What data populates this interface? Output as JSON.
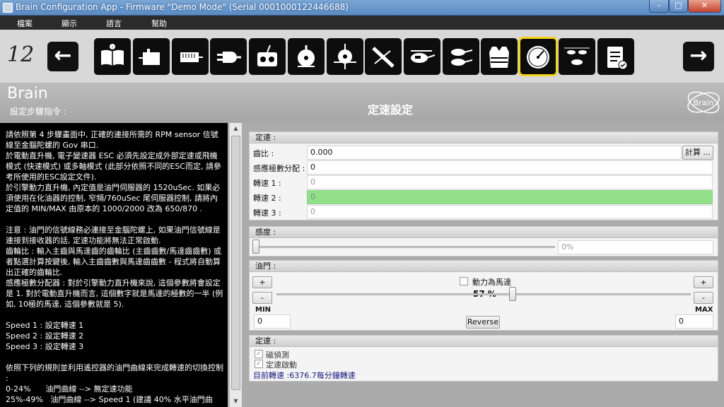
{
  "window": {
    "title": "Brain Configuration App - Firmware \"Demo Mode\" (Serial 0001000122446688)",
    "min": "–",
    "max": "□",
    "close": "✕"
  },
  "menu": [
    "檔案",
    "顯示",
    "語言",
    "幫助"
  ],
  "toolbar": {
    "step_number": "12",
    "back_arrow": "←",
    "forward_arrow": "→",
    "icons": [
      "manual-icon",
      "control-box-icon",
      "receiver-icon",
      "plug-icon",
      "transmitter-icon",
      "swashplate-icon",
      "rotor-head-icon",
      "tail-rotor-icon",
      "helicopter-icon",
      "helicopter-stabilized-icon",
      "helicopters-icon",
      "vest-icon",
      "speedometer-icon",
      "helicopters-flight-icon",
      "checklist-icon"
    ],
    "active_icon": "speedometer-icon"
  },
  "header": {
    "brand": "Brain",
    "subtitle": "設定步驟指令 :",
    "title": "定速設定",
    "logo_text": "Brain"
  },
  "instructions": [
    "請依照第 4 步驟畫面中, 正確的連接所需的 RPM sensor 信號線至金腦陀螺的 Gov 串口.",
    "於電動直升機, 電子變速器 ESC 必須先設定成外部定速或飛機模式 (快速模式) 或多軸模式 (此部分依照不同的ESC而定, 請參考所使用的ESC設定文件).",
    "於引擎動力直升機, 內定值是油門伺服器的 1520uSec. 如果必須使用在化油器的控制, 窄頻/760uSec 尾伺服器控制, 請將內定值的 MIN/MAX 由原本的 1000/2000 改為 650/870 .",
    "",
    "注意 : 油門的信號線務必連接至金腦陀螺上, 如果油門信號線是連接到接收器的話, 定速功能將無法正常啟動.",
    "齒輪比 : 輸入主齒與馬達齒的齒輪比 (主齒齒數/馬達齒齒數) 或者點選計算按鍵後, 輸入主齒齒數與馬達齒齒數 - 程式將自動算出正確的齒輪比.",
    "感應極數分配器 : 對於引擎動力直升機來說, 這個參數將會設定是 1. 對於電動直升機而言, 這個數字就是馬達的極數的一半 (例如, 10極的馬達, 這個參數就是 5).",
    "",
    "Speed 1 : 設定轉速 1",
    "Speed 2 : 設定轉速 2",
    "Speed 3 : 設定轉速 3",
    "",
    "依照下列的規則並利用遙控器的油門曲線來完成轉速的切換控制 :",
    "0-24%      油門曲線 --> 無定速功能",
    "25%-49%   油門曲線 --> Speed 1 (建議 40% 水平油門曲"
  ],
  "governor_panel": {
    "header": "定速 :",
    "gear_ratio_label": "齒比 :",
    "gear_ratio_value": "0.000",
    "calc_button": "計算 ...",
    "pole_divider_label": "感應極數分配 :",
    "pole_divider_value": "0",
    "speed1_label": "轉速 1 :",
    "speed1_value": "0",
    "speed2_label": "轉速 2 :",
    "speed2_value": "0",
    "speed3_label": "轉速 3 :",
    "speed3_value": "0"
  },
  "sensitivity_panel": {
    "header": "感度 :",
    "value": "0%",
    "level": 0
  },
  "throttle_panel": {
    "header": "油門 :",
    "motor_checkbox_label": "動力為馬達",
    "percent": "57 %",
    "level": 0.57,
    "plus": "+",
    "minus": "-",
    "min_label": "MIN",
    "max_label": "MAX",
    "min_value": "0",
    "max_value": "0",
    "reverse_button": "Reverse"
  },
  "status_panel": {
    "header": "定速 :",
    "magnetic_detect_label": "磁偵測",
    "governor_start_label": "定速啟動",
    "current_rpm_text": "目前轉速 :6376.7每分鐘轉速"
  },
  "colors": {
    "active_speed": "#93e08a",
    "active_tool_outline": "#f3d21a"
  }
}
